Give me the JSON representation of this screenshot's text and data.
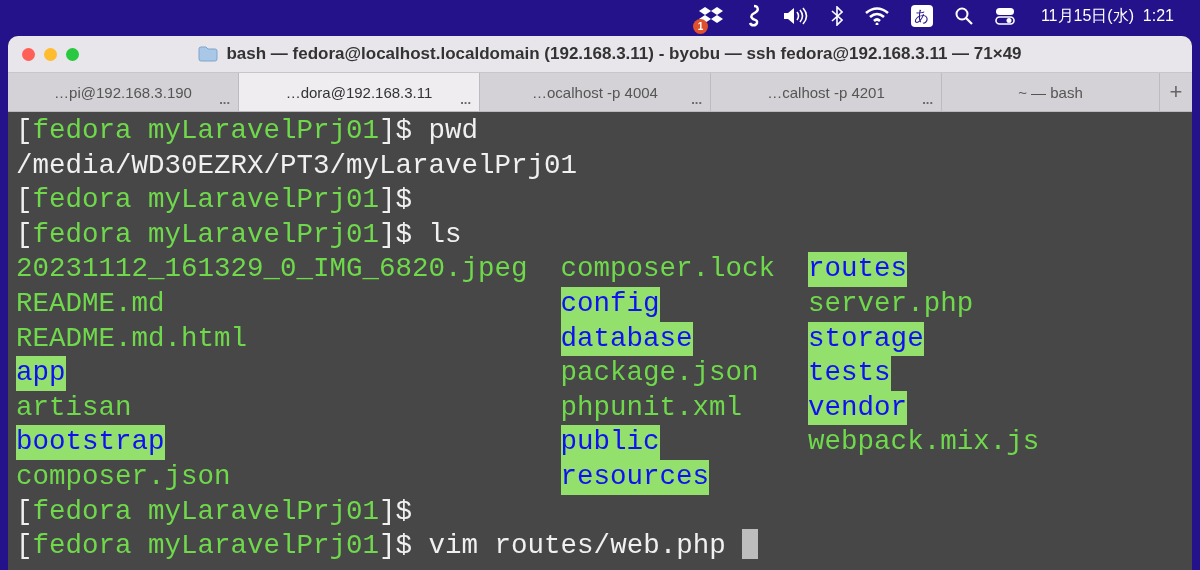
{
  "menu_bar": {
    "dropbox_badge": "1",
    "input_method": "あ",
    "clock": "11月15日(水)  1:21"
  },
  "window": {
    "title": "bash — fedora@localhost.localdomain (192.168.3.11) - byobu — ssh fedora@192.168.3.11 — 71×49"
  },
  "tabs": [
    {
      "label": "…pi@192.168.3.190",
      "selected": false,
      "more": "..."
    },
    {
      "label": "…dora@192.168.3.11",
      "selected": true,
      "more": "..."
    },
    {
      "label": "…ocalhost -p 4004",
      "selected": false,
      "more": "..."
    },
    {
      "label": "…calhost -p 4201",
      "selected": false,
      "more": "..."
    },
    {
      "label": "~ — bash",
      "selected": false
    }
  ],
  "new_tab": "+",
  "terminal": {
    "lines": [
      {
        "kind": "prompt",
        "open": "[",
        "user_dir": "fedora myLaravelPrj01",
        "close": "]$",
        "command": "pwd",
        "cursor": false
      },
      {
        "kind": "output",
        "text": "/media/WD30EZRX/PT3/myLaravelPrj01"
      },
      {
        "kind": "prompt",
        "open": "[",
        "user_dir": "fedora myLaravelPrj01",
        "close": "]$",
        "cursor": false
      },
      {
        "kind": "prompt",
        "open": "[",
        "user_dir": "fedora myLaravelPrj01",
        "close": "]$",
        "command": "ls",
        "cursor": false
      },
      {
        "kind": "listing",
        "columns": [
          [
            {
              "name": "20231112_161329_0_IMG_6820.jpeg",
              "kind": "file"
            },
            {
              "name": "README.md",
              "kind": "file"
            },
            {
              "name": "README.md.html",
              "kind": "file"
            },
            {
              "name": "app",
              "kind": "dir"
            },
            {
              "name": "artisan",
              "kind": "file"
            },
            {
              "name": "bootstrap",
              "kind": "dir"
            },
            {
              "name": "composer.json",
              "kind": "file"
            }
          ],
          [
            {
              "name": "composer.lock",
              "kind": "file"
            },
            {
              "name": "config",
              "kind": "dir"
            },
            {
              "name": "database",
              "kind": "dir"
            },
            {
              "name": "package.json",
              "kind": "file"
            },
            {
              "name": "phpunit.xml",
              "kind": "file"
            },
            {
              "name": "public",
              "kind": "dir"
            },
            {
              "name": "resources",
              "kind": "dir"
            }
          ],
          [
            {
              "name": "routes",
              "kind": "dir"
            },
            {
              "name": "server.php",
              "kind": "file"
            },
            {
              "name": "storage",
              "kind": "dir"
            },
            {
              "name": "tests",
              "kind": "dir"
            },
            {
              "name": "vendor",
              "kind": "dir"
            },
            {
              "name": "webpack.mix.js",
              "kind": "file"
            }
          ]
        ]
      },
      {
        "kind": "prompt",
        "open": "[",
        "user_dir": "fedora myLaravelPrj01",
        "close": "]$",
        "cursor": false
      },
      {
        "kind": "prompt",
        "open": "[",
        "user_dir": "fedora myLaravelPrj01",
        "close": "]$",
        "command": "vim routes/web.php",
        "cursor": true
      }
    ]
  }
}
